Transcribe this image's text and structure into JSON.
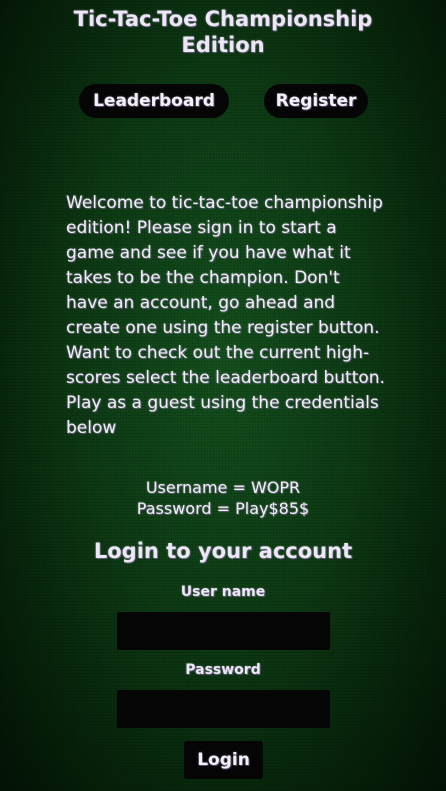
{
  "header": {
    "title_line1": "Tic-Tac-Toe Championship",
    "title_line2": "Edition"
  },
  "nav": {
    "leaderboard_label": "Leaderboard",
    "register_label": "Register"
  },
  "welcome_text": "Welcome to tic-tac-toe championship edition! Please sign in to start a game and see if you have what it takes to be the champion. Don't have an account, go ahead and create one using the register button. Want to check out the current high-scores select the leaderboard button. Play as a guest using the credentials below",
  "guest": {
    "username_line": "Username = WOPR",
    "password_line": "Password = Play$85$"
  },
  "login": {
    "heading": "Login to your account",
    "username_label": "User name",
    "username_value": "",
    "password_label": "Password",
    "password_value": "",
    "button_label": "Login"
  },
  "colors": {
    "background": "#0d3a14",
    "text": "#f2eef8",
    "button_bg": "#050505"
  }
}
